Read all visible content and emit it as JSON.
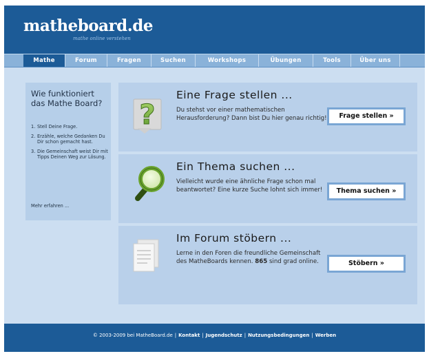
{
  "header": {
    "logo": "matheboard.de",
    "tagline": "mathe online verstehen"
  },
  "nav": {
    "items": [
      {
        "label": "Mathe",
        "active": true
      },
      {
        "label": "Forum",
        "active": false
      },
      {
        "label": "Fragen",
        "active": false
      },
      {
        "label": "Suchen",
        "active": false
      },
      {
        "label": "Workshops",
        "active": false
      },
      {
        "label": "Übungen",
        "active": false
      },
      {
        "label": "Tools",
        "active": false
      },
      {
        "label": "Über uns",
        "active": false
      }
    ]
  },
  "sidebar": {
    "title": "Wie funktioniert das Mathe Board?",
    "steps": [
      {
        "num": "1.",
        "text": "Stell Deine Frage."
      },
      {
        "num": "2.",
        "text": "Erzähle, welche Gedanken Du Dir schon gemacht hast."
      },
      {
        "num": "3.",
        "text": "Die Gemeinschaft weist Dir mit Tipps Deinen Weg zur Lösung."
      }
    ],
    "more_link": "Mehr erfahren ..."
  },
  "panels": {
    "ask": {
      "title": "Eine Frage stellen ...",
      "text": "Du stehst vor einer mathematischen Herausforderung? Dann bist Du hier genau richtig!",
      "button": "Frage stellen »",
      "icon": "question-mark-icon"
    },
    "search": {
      "title": "Ein Thema suchen ...",
      "text": "Vielleicht wurde eine ähnliche Frage schon mal beantwortet? Eine kurze Suche lohnt sich immer!",
      "button": "Thema suchen »",
      "icon": "magnifier-icon"
    },
    "forum": {
      "title": "Im Forum stöbern ...",
      "text_before": "Lerne in den Foren die freundliche Gemeinschaft des MatheBoards kennen.",
      "online_count": "865",
      "text_after": "sind grad online.",
      "button": "Stöbern »",
      "icon": "documents-icon"
    }
  },
  "footer": {
    "copyright": "© 2003-2009 bei MatheBoard.de",
    "links": [
      "Kontakt",
      "Jugendschutz",
      "Nutzungsbedingungen",
      "Werben"
    ]
  },
  "colors": {
    "header_blue": "#1c5b97",
    "nav_blue": "#8ab2d9",
    "panel_bg": "#b9d0ea",
    "page_bg": "#ccdef1",
    "button_border": "#7aa6d4",
    "icon_green": "#7cb342"
  }
}
